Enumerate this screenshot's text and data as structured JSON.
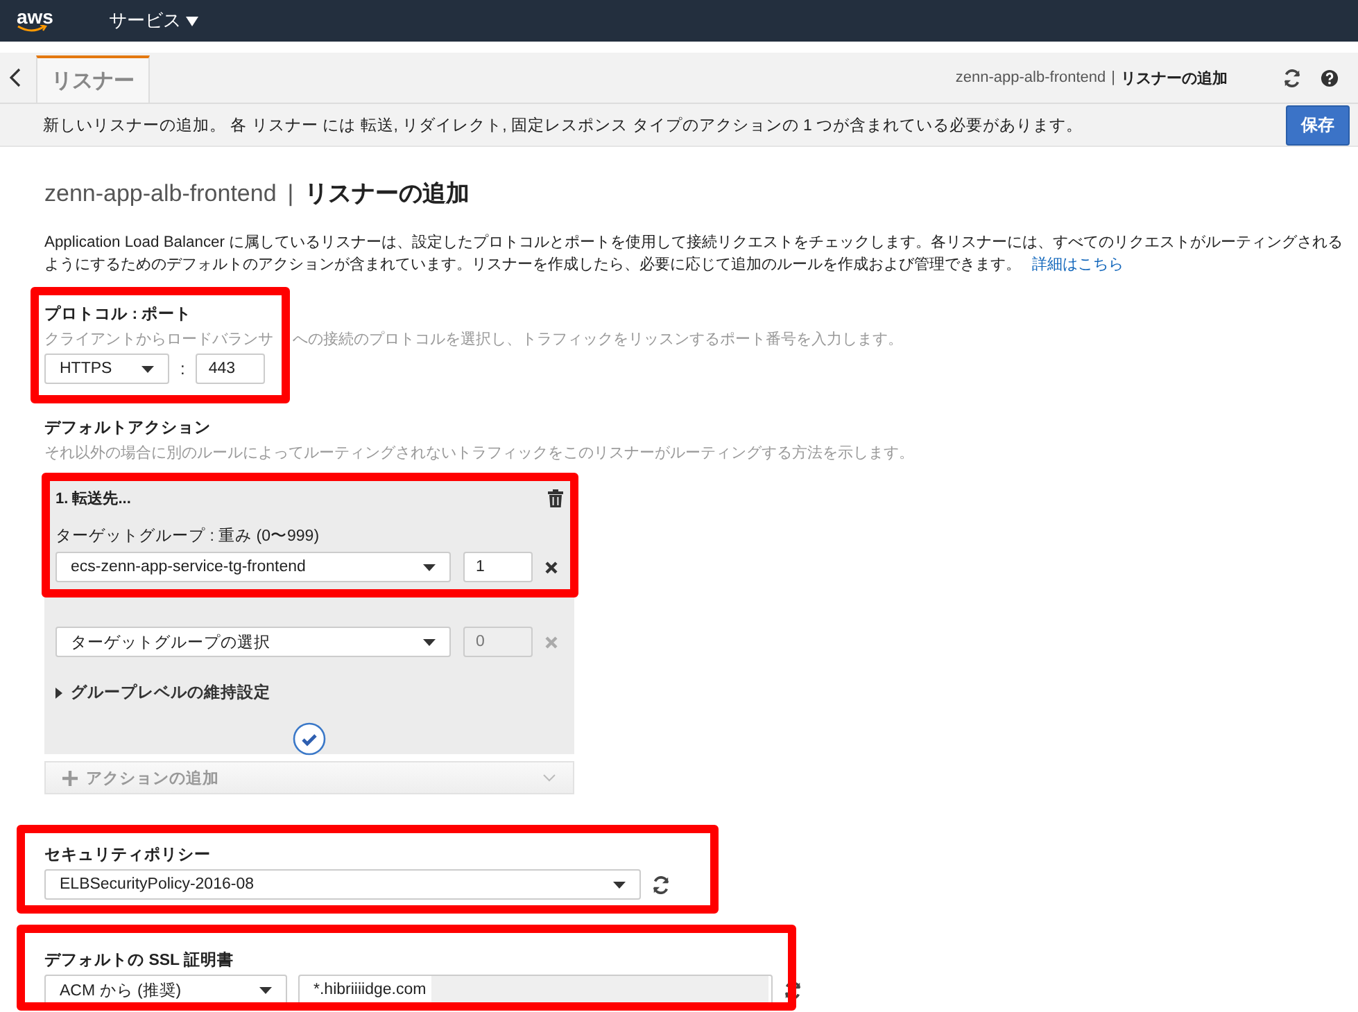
{
  "top_nav": {
    "logo": "aws",
    "services_menu": "サービス"
  },
  "header": {
    "tab": {
      "label": "リスナー",
      "selected": true
    },
    "breadcrumb_lb": "zenn-app-alb-frontend",
    "breadcrumb_sep": "|",
    "breadcrumb_page": "リスナーの追加"
  },
  "info_bar": {
    "text": "新しいリスナーの追加。 各 リスナー には 転送, リダイレクト, 固定レスポンス タイプのアクションの 1 つが含まれている必要があります。",
    "save_button": "保存"
  },
  "page_title": {
    "lb": "zenn-app-alb-frontend",
    "sep": "|",
    "title": "リスナーの追加"
  },
  "description": {
    "lines": [
      "Application Load Balancer に属しているリスナーは、設定したプロトコルとポートを使用して接続リクエストをチェックします。各リスナーには、すべてのリクエストがルーティングされる",
      "ようにするためのデフォルトのアクションが含まれています。リスナーを作成したら、必要に応じて追加のルールを作成および管理できます。"
    ],
    "link": "詳細はこちら"
  },
  "protocol_port": {
    "label": "プロトコル : ポート",
    "hint_parts": [
      "クライアントからロードバランサ",
      "への接続のプロトコルを選択し、トラフィックをリッスンするポート番号を入力します。"
    ],
    "protocol": "HTTPS",
    "colon": ":",
    "port": "443"
  },
  "default_action": {
    "label": "デフォルトアクション",
    "hint": "それ以外の場合に別のルールによってルーティングされないトラフィックをこのリスナーがルーティングする方法を示します。",
    "action_title": "1. 転送先...",
    "weight_label": "ターゲットグループ : 重み (0〜999)",
    "target_groups": [
      {
        "value": "ecs-zenn-app-service-tg-frontend",
        "weight": "1",
        "disabled": false
      },
      {
        "placeholder": "ターゲットグループの選択",
        "weight": "0",
        "disabled": true
      }
    ],
    "stickiness": {
      "label": "グループレベルの維持設定",
      "expanded": false
    },
    "add_action": "アクションの追加"
  },
  "security_policy": {
    "label": "セキュリティポリシー",
    "value": "ELBSecurityPolicy-2016-08"
  },
  "ssl_certificate": {
    "label": "デフォルトの SSL 証明書",
    "source": "ACM から (推奨)",
    "certificate": "*.hibriiiidge.com"
  }
}
